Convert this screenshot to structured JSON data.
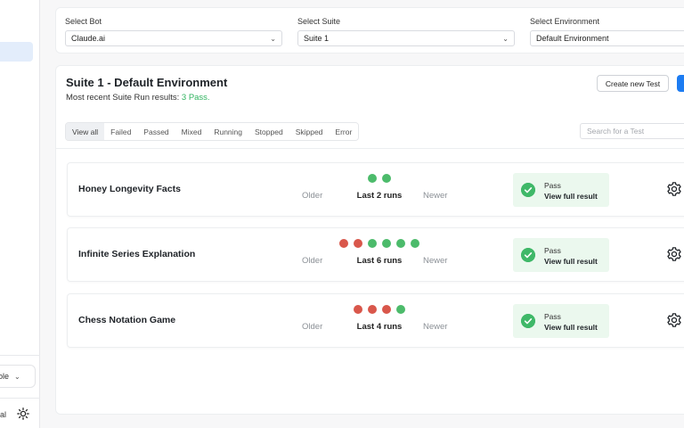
{
  "sidebar": {
    "org_select_label": "ole",
    "user_label": "al"
  },
  "selectors": {
    "bot": {
      "label": "Select Bot",
      "value": "Claude.ai"
    },
    "suite": {
      "label": "Select Suite",
      "value": "Suite 1"
    },
    "environment": {
      "label": "Select Environment",
      "value": "Default Environment"
    }
  },
  "main": {
    "title": "Suite 1 - Default Environment",
    "subtitle_prefix": "Most recent Suite Run results:",
    "subtitle_pass": "3 Pass.",
    "create_button": "Create new Test",
    "filters": [
      "View all",
      "Failed",
      "Passed",
      "Mixed",
      "Running",
      "Stopped",
      "Skipped",
      "Error"
    ],
    "active_filter": "View all",
    "search_placeholder": "Search for a Test"
  },
  "labels": {
    "older": "Older",
    "newer": "Newer"
  },
  "tests": [
    {
      "name": "Honey Longevity Facts",
      "runs_label": "Last 2 runs",
      "runs": [
        "pass",
        "pass"
      ],
      "status": "Pass",
      "link": "View full result"
    },
    {
      "name": "Infinite Series Explanation",
      "runs_label": "Last 6 runs",
      "runs": [
        "fail",
        "fail",
        "pass",
        "pass",
        "pass",
        "pass"
      ],
      "status": "Pass",
      "link": "View full result"
    },
    {
      "name": "Chess Notation Game",
      "runs_label": "Last 4 runs",
      "runs": [
        "fail",
        "fail",
        "fail",
        "pass"
      ],
      "status": "Pass",
      "link": "View full result"
    }
  ],
  "colors": {
    "pass": "#4cbb6b",
    "fail": "#d9574b",
    "accent": "#1d7cf2",
    "pass_text": "#2fb35f"
  }
}
